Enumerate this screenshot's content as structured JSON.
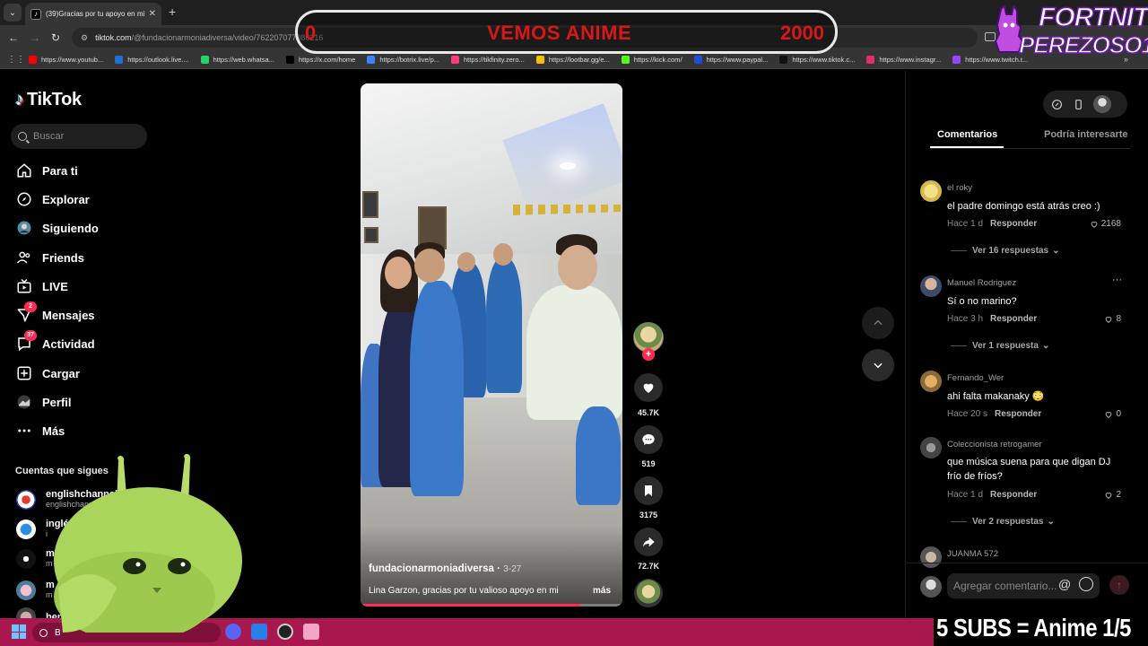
{
  "browser": {
    "tab_title": "(39)Gracias por tu apoyo en mi",
    "tab_favicon": "tiktok-icon",
    "url_host": "tiktok.com",
    "url_path": "/@fundacionarmoniadiversa/video/7622070",
    "url_tail": "77086216",
    "bookmarks": [
      {
        "label": "https://www.youtub...",
        "color": "#ff0000"
      },
      {
        "label": "https://outlook.live....",
        "color": "#1e6fd9"
      },
      {
        "label": "https://web.whatsa...",
        "color": "#25d366"
      },
      {
        "label": "https://x.com/home",
        "color": "#000000"
      },
      {
        "label": "https://botrix.live/p...",
        "color": "#3b82f6"
      },
      {
        "label": "https://tikfinity.zero...",
        "color": "#ff3b7f"
      },
      {
        "label": "https://lootbar.gg/e...",
        "color": "#f2c200"
      },
      {
        "label": "https://kick.com/",
        "color": "#53fc18"
      },
      {
        "label": "https://www.paypal...",
        "color": "#1d4ed8"
      },
      {
        "label": "https://www.tiktok.c...",
        "color": "#111111"
      },
      {
        "label": "https://www.instagr...",
        "color": "#e1306c"
      },
      {
        "label": "https://www.twitch.t...",
        "color": "#9146ff"
      }
    ],
    "more_label": "»"
  },
  "overlay": {
    "goal_min": "0",
    "goal_title": "VEMOS ANIME",
    "goal_max": "2000",
    "fortnite_line1": "FORTNITE",
    "fortnite_line2": "PEREZOSO1",
    "banner": "5 SUBS = Anime 1/5"
  },
  "tiktok": {
    "logo": "TikTok",
    "search_placeholder": "Buscar",
    "nav": [
      {
        "key": "para-ti",
        "label": "Para ti",
        "icon": "home-icon"
      },
      {
        "key": "explorar",
        "label": "Explorar",
        "icon": "compass-icon"
      },
      {
        "key": "siguiendo",
        "label": "Siguiendo",
        "icon": "following-avatar-icon"
      },
      {
        "key": "friends",
        "label": "Friends",
        "icon": "friends-icon"
      },
      {
        "key": "live",
        "label": "LIVE",
        "icon": "live-icon"
      },
      {
        "key": "mensajes",
        "label": "Mensajes",
        "icon": "message-icon",
        "badge": "2"
      },
      {
        "key": "actividad",
        "label": "Actividad",
        "icon": "activity-icon",
        "badge": "37"
      },
      {
        "key": "cargar",
        "label": "Cargar",
        "icon": "upload-icon"
      },
      {
        "key": "perfil",
        "label": "Perfil",
        "icon": "profile-avatar-icon"
      },
      {
        "key": "mas",
        "label": "Más",
        "icon": "more-icon"
      }
    ],
    "following_title": "Cuentas que sigues",
    "following": [
      {
        "name": "englishchannel",
        "handle": "englishchannel"
      },
      {
        "name": "inglés",
        "handle": "i"
      },
      {
        "name": "m",
        "handle": "m"
      },
      {
        "name": "m",
        "handle": "m"
      },
      {
        "name": "ben",
        "handle": ""
      }
    ]
  },
  "video": {
    "author": "fundacionarmoniadiversa",
    "date": "3-27",
    "caption": "Lina Garzon, gracias por tu valioso apoyo en mi",
    "more": "más",
    "progress": 0.84,
    "likes": "45.7K",
    "comments": "519",
    "saves": "3175",
    "shares": "72.7K"
  },
  "comments_panel": {
    "tab_comments": "Comentarios",
    "tab_related": "Podría interesarte",
    "comments": [
      {
        "user": "el roky",
        "text": "el padre domingo está atrás creo :)",
        "time": "Hace 1 d",
        "reply": "Responder",
        "likes": "2168",
        "view_replies": "Ver 16 respuestas"
      },
      {
        "user": "Manuel Rodriguez",
        "text": "Sí o no marino?",
        "time": "Hace 3 h",
        "reply": "Responder",
        "likes": "8",
        "view_replies": "Ver 1 respuesta"
      },
      {
        "user": "Fernando_Wer",
        "text": "ahi falta makanaky 😳",
        "time": "Hace 20 s",
        "reply": "Responder",
        "likes": "0",
        "view_replies": ""
      },
      {
        "user": "Coleccionista retrogamer",
        "text": "que música suena para que digan DJ frío de fríos?",
        "time": "Hace 1 d",
        "reply": "Responder",
        "likes": "2",
        "view_replies": "Ver 2 respuestas"
      },
      {
        "user": "JUANMA 572",
        "text": "",
        "time": "",
        "reply": "",
        "likes": "",
        "view_replies": ""
      }
    ],
    "more_dots": "···",
    "add_placeholder": "Agregar comentario...",
    "at_symbol": "@"
  },
  "taskbar": {
    "search_text": "B"
  },
  "colors": {
    "accent": "#fe2c55",
    "taskbar": "#a8174d",
    "goal_text": "#d81818"
  }
}
